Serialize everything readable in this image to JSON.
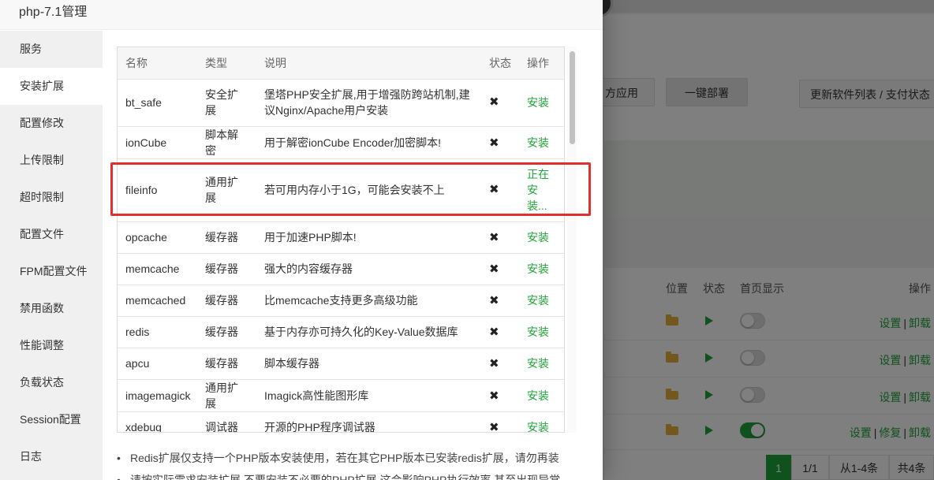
{
  "background": {
    "buttons": {
      "third_party": "方应用",
      "one_click_deploy": "一键部署",
      "update_list": "更新软件列表 / 支付状态"
    },
    "headers": {
      "location": "位置",
      "status": "状态",
      "homepage": "首页显示",
      "ops": "操作"
    },
    "rows": [
      {
        "toggle": "off",
        "ops": [
          "设置",
          "卸载"
        ]
      },
      {
        "toggle": "off",
        "ops": [
          "设置",
          "卸载"
        ]
      },
      {
        "toggle": "off",
        "ops": [
          "设置",
          "卸载"
        ]
      },
      {
        "toggle": "on",
        "ops": [
          "设置",
          "修复",
          "卸载"
        ]
      }
    ],
    "pager": {
      "current": "1",
      "pages": "1/1",
      "range": "从1-4条",
      "total": "共4条"
    }
  },
  "dialog": {
    "title": "php-7.1管理",
    "sidebar": [
      {
        "label": "服务"
      },
      {
        "label": "安装扩展"
      },
      {
        "label": "配置修改"
      },
      {
        "label": "上传限制"
      },
      {
        "label": "超时限制"
      },
      {
        "label": "配置文件"
      },
      {
        "label": "FPM配置文件"
      },
      {
        "label": "禁用函数"
      },
      {
        "label": "性能调整"
      },
      {
        "label": "负载状态"
      },
      {
        "label": "Session配置"
      },
      {
        "label": "日志"
      }
    ],
    "table": {
      "headers": {
        "name": "名称",
        "type": "类型",
        "desc": "说明",
        "status": "状态",
        "op": "操作"
      },
      "rows": [
        {
          "name": "bt_safe",
          "type": "安全扩展",
          "desc": "堡塔PHP安全扩展,用于增强防跨站机制,建议Nginx/Apache用户安装",
          "status": "✖",
          "op": "安装"
        },
        {
          "name": "ionCube",
          "type": "脚本解密",
          "desc": "用于解密ionCube Encoder加密脚本!",
          "status": "✖",
          "op": "安装"
        },
        {
          "name": "fileinfo",
          "type": "通用扩展",
          "desc": "若可用内存小于1G，可能会安装不上",
          "status": "✖",
          "op": "正在安装..."
        },
        {
          "name": "opcache",
          "type": "缓存器",
          "desc": "用于加速PHP脚本!",
          "status": "✖",
          "op": "安装"
        },
        {
          "name": "memcache",
          "type": "缓存器",
          "desc": "强大的内容缓存器",
          "status": "✖",
          "op": "安装"
        },
        {
          "name": "memcached",
          "type": "缓存器",
          "desc": "比memcache支持更多高级功能",
          "status": "✖",
          "op": "安装"
        },
        {
          "name": "redis",
          "type": "缓存器",
          "desc": "基于内存亦可持久化的Key-Value数据库",
          "status": "✖",
          "op": "安装"
        },
        {
          "name": "apcu",
          "type": "缓存器",
          "desc": "脚本缓存器",
          "status": "✖",
          "op": "安装"
        },
        {
          "name": "imagemagick",
          "type": "通用扩展",
          "desc": "Imagick高性能图形库",
          "status": "✖",
          "op": "安装"
        },
        {
          "name": "xdebug",
          "type": "调试器",
          "desc": "开源的PHP程序调试器",
          "status": "✖",
          "op": "安装"
        }
      ]
    },
    "notes": [
      "Redis扩展仅支持一个PHP版本安装使用，若在其它PHP版本已安装redis扩展，请勿再装",
      "请按实际需求安装扩展,不要安装不必要的PHP扩展,这会影响PHP执行效率,甚至出现异常"
    ]
  },
  "colors": {
    "accent": "#20a53a",
    "highlight": "#e02f2f"
  }
}
